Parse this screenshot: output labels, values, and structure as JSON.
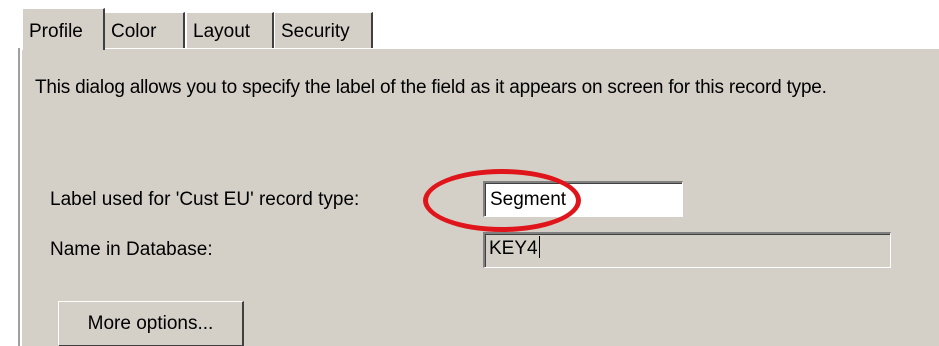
{
  "tabs": [
    {
      "label": "Profile",
      "active": true
    },
    {
      "label": "Color",
      "active": false
    },
    {
      "label": "Layout",
      "active": false
    },
    {
      "label": "Security",
      "active": false
    }
  ],
  "profile": {
    "description": "This dialog allows you to specify the label of the field as it appears on screen for this record type.",
    "label_field_caption": "Label used for 'Cust EU' record type:",
    "label_field_value": "Segment",
    "db_name_caption": "Name in Database:",
    "db_name_value": "KEY4",
    "more_options_label": "More options..."
  },
  "colors": {
    "panel_bg": "#d4d0c8",
    "highlight": "#e0151b"
  }
}
